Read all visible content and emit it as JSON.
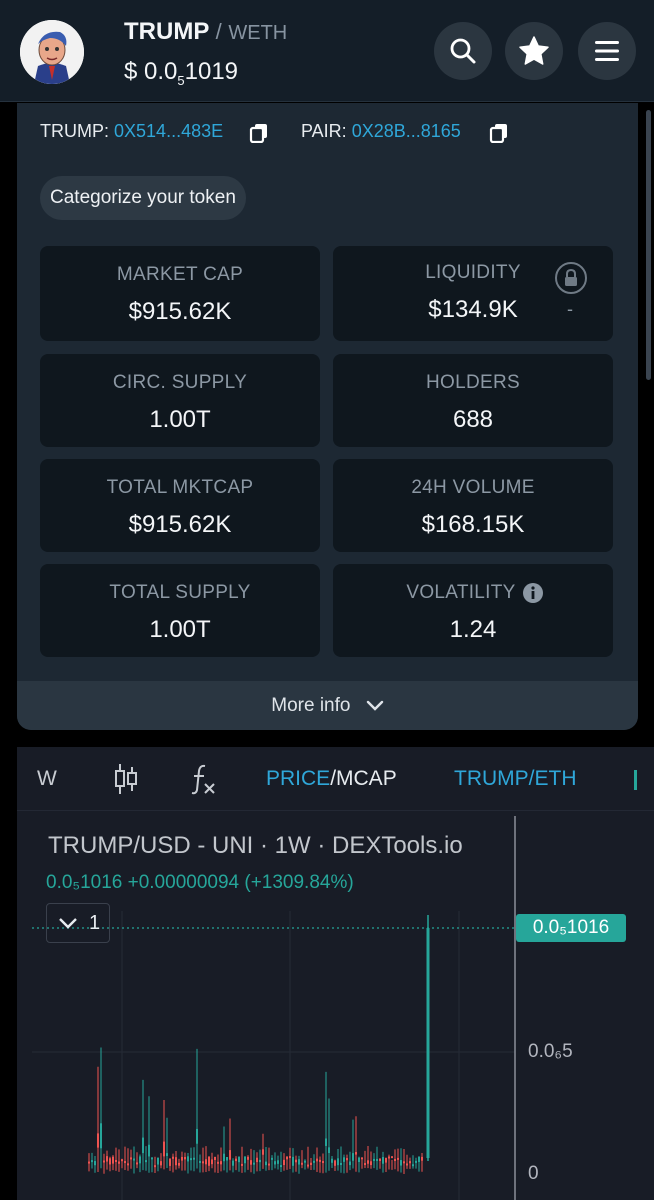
{
  "header": {
    "base_token": "TRUMP",
    "separator": "/",
    "quote_token": "WETH",
    "price_prefix": "$ 0.0",
    "price_zeros": "5",
    "price_digits": "1019"
  },
  "addresses": {
    "token_label": "TRUMP:",
    "token_address": "0X514...483E",
    "pair_label": "PAIR:",
    "pair_address": "0X28B...8165"
  },
  "categorize_label": "Categorize your token",
  "stats": {
    "market_cap": {
      "label": "MARKET CAP",
      "value": "$915.62K"
    },
    "liquidity": {
      "label": "LIQUIDITY",
      "value": "$134.9K",
      "extra": "-"
    },
    "circ_supply": {
      "label": "CIRC. SUPPLY",
      "value": "1.00T"
    },
    "holders": {
      "label": "HOLDERS",
      "value": "688"
    },
    "total_mktcap": {
      "label": "TOTAL MKTCAP",
      "value": "$915.62K"
    },
    "volume_24h": {
      "label": "24H VOLUME",
      "value": "$168.15K"
    },
    "total_supply": {
      "label": "TOTAL SUPPLY",
      "value": "1.00T"
    },
    "volatility": {
      "label": "VOLATILITY",
      "value": "1.24"
    }
  },
  "more_info_label": "More info",
  "chart_toolbar": {
    "interval": "W",
    "price_label": "PRICE",
    "mcap_label": "/MCAP",
    "pair_label": "TRUMP/ETH"
  },
  "chart": {
    "title": "TRUMP/USD - UNI · 1W · DEXTools.io",
    "subtitle": "0.0₅1016  +0.00000094 (+1309.84%)",
    "collapse_count": "1",
    "last_price_tag": "0.0₅1016",
    "axis_mid": "0.0₆5",
    "axis_zero": "0"
  },
  "colors": {
    "accent": "#2fa7d9",
    "up": "#26a69a",
    "down": "#ef5350",
    "card_bg": "#1d2833",
    "stat_bg": "#0f171e"
  },
  "icons": [
    "search-icon",
    "star-icon",
    "menu-icon",
    "copy-icon",
    "lock-icon",
    "info-icon",
    "chevron-down-icon",
    "candles-icon",
    "fx-icon"
  ],
  "chart_data": {
    "type": "candlestick",
    "title": "TRUMP/USD - UNI · 1W · DEXTools.io",
    "y_tick_labels": [
      "0",
      "0.0₆5",
      "0.0₅1016"
    ],
    "last_value": "0.0₅1016",
    "change": "+0.00000094 (+1309.84%)",
    "note": "weekly candles, prices near zero then a final spike to 0.0₅1016"
  }
}
